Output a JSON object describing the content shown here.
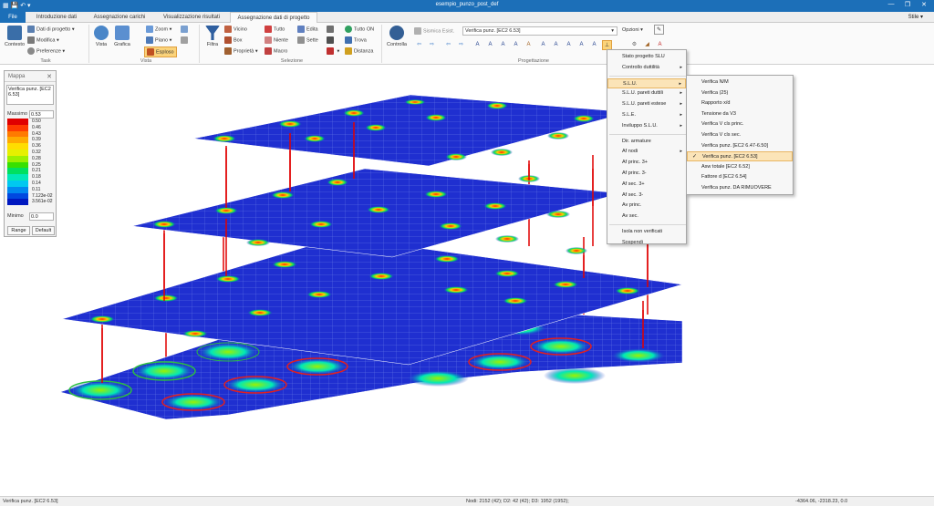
{
  "window": {
    "title": "esempio_punzo_post_def"
  },
  "tabs": [
    {
      "label": "File"
    },
    {
      "label": "Introduzione dati"
    },
    {
      "label": "Assegnazione carichi"
    },
    {
      "label": "Visualizzazione risultati"
    },
    {
      "label": "Assegnazione dati di progetto"
    }
  ],
  "stile": "Stile",
  "ribbon": {
    "task": {
      "title": "Task",
      "contesto": "Contesto",
      "dati_progetto": "Dati di progetto",
      "modifica": "Modifica",
      "preferenze": "Preferenze"
    },
    "vista": {
      "title": "Vista",
      "vista": "Vista",
      "grafica": "Grafica",
      "zoom": "Zoom",
      "piano": "Piano",
      "esploso": "Esploso"
    },
    "selezione": {
      "title": "Selezione",
      "filtra": "Filtra",
      "vicino": "Vicino",
      "box": "Box",
      "proprieta": "Proprietà",
      "tutto": "Tutto",
      "niente": "Niente",
      "macro": "Macro",
      "edita": "Edita",
      "sette": "Sette",
      "tutto_on": "Tutto ON",
      "trova": "Trova",
      "distanza": "Distanza"
    },
    "progettazione": {
      "title": "Progettazione",
      "controlla": "Controlla",
      "sismica": "Sismica Esist.",
      "combo": "Verifica punz. [EC2 6.53]",
      "opzioni": "Opzioni"
    }
  },
  "mappa": {
    "title": "Mappa",
    "description": "Verifica punz. [EC2 6.53]",
    "massimo_label": "Massimo",
    "massimo_value": "0.53",
    "minimo_label": "Minimo",
    "minimo_value": "0.0",
    "range_button": "Range",
    "default_button": "Default",
    "legend": [
      {
        "value": "0.50",
        "color": "#e00000"
      },
      {
        "value": "0.46",
        "color": "#ff3a00"
      },
      {
        "value": "0.43",
        "color": "#ff7a00"
      },
      {
        "value": "0.39",
        "color": "#ffaa00"
      },
      {
        "value": "0.36",
        "color": "#ffdd00"
      },
      {
        "value": "0.32",
        "color": "#e6f000"
      },
      {
        "value": "0.28",
        "color": "#9cf000"
      },
      {
        "value": "0.25",
        "color": "#38e000"
      },
      {
        "value": "0.21",
        "color": "#00e060"
      },
      {
        "value": "0.18",
        "color": "#00e8b8"
      },
      {
        "value": "0.14",
        "color": "#00c8f0"
      },
      {
        "value": "0.11",
        "color": "#0088f0"
      },
      {
        "value": "7.123e-02",
        "color": "#0048e0"
      },
      {
        "value": "3.561e-02",
        "color": "#0018c0"
      }
    ]
  },
  "menu_main": [
    {
      "label": "Stato progetto SLU",
      "arrow": false
    },
    {
      "label": "Controllo duttilità",
      "arrow": true
    },
    {
      "sep": true
    },
    {
      "label": "S.L.U.",
      "arrow": true,
      "highlight": true
    },
    {
      "label": "S.L.U. pareti duttili",
      "arrow": true
    },
    {
      "label": "S.L.U. pareti estese",
      "arrow": true
    },
    {
      "label": "S.L.E.",
      "arrow": true
    },
    {
      "label": "Inviluppo S.L.U.",
      "arrow": true
    },
    {
      "sep": true
    },
    {
      "label": "Dir. armature",
      "arrow": false
    },
    {
      "label": "Af nodi",
      "arrow": true
    },
    {
      "label": "Af princ. 3+",
      "arrow": false
    },
    {
      "label": "Af princ. 3-",
      "arrow": false
    },
    {
      "label": "Af sec. 3+",
      "arrow": false
    },
    {
      "label": "Af sec. 3-",
      "arrow": false
    },
    {
      "label": "Av princ.",
      "arrow": false
    },
    {
      "label": "Av sec.",
      "arrow": false
    },
    {
      "sep": true
    },
    {
      "label": "Isola non verificati",
      "arrow": false
    },
    {
      "label": "Sospendi",
      "arrow": false
    }
  ],
  "menu_sub": [
    {
      "label": "Verifica N/M"
    },
    {
      "label": "Verifica (25)"
    },
    {
      "label": "Rapporto x/d"
    },
    {
      "label": "Tensione da V3"
    },
    {
      "label": "Verifica V cls princ."
    },
    {
      "label": "Verifica V cls sec."
    },
    {
      "label": "Verifica punz. [EC2 6.47-6.50]"
    },
    {
      "label": "Verifica punz. [EC2 6.53]",
      "checked": true
    },
    {
      "label": "Asw totale [EC2 6.52]"
    },
    {
      "label": "Fattore d [EC2 6.54]"
    },
    {
      "label": "Verifica punz. DA RIMUOVERE"
    }
  ],
  "status": {
    "left": "Verifica punz. [EC2 6.53]",
    "center": "Nodi: 2152 (42); D2: 42 (42); D3: 1952 (1952);",
    "right": "-4364.06, -2318.23, 0.0"
  },
  "colors": {
    "accent": "#1c6fb8",
    "slab": "#1f2fd0",
    "grid": "#6b7fe8",
    "column": "#e00000"
  }
}
